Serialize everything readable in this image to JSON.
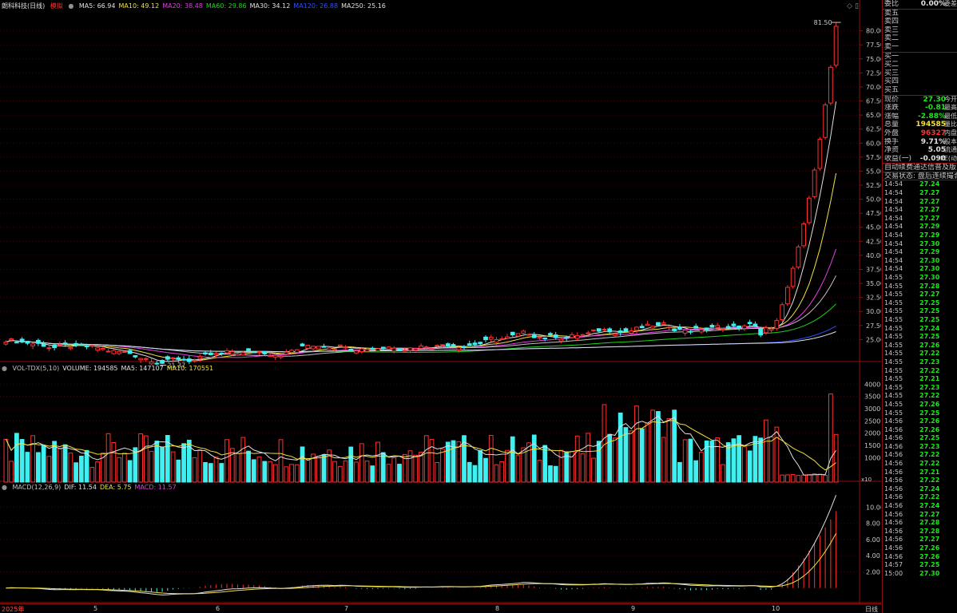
{
  "header": {
    "stock_name": "朗科科技(日线)",
    "mode": "模拟",
    "ma": [
      {
        "label": "MA5: 66.94",
        "color": "#e0e0e0"
      },
      {
        "label": "MA10: 49.12",
        "color": "#f0e040"
      },
      {
        "label": "MA20: 38.48",
        "color": "#e040e0"
      },
      {
        "label": "MA60: 29.86",
        "color": "#20d020"
      },
      {
        "label": "MA30: 34.12",
        "color": "#e0e0e0"
      },
      {
        "label": "MA120: 26.88",
        "color": "#3050ff"
      },
      {
        "label": "MA250: 25.16",
        "color": "#e0e0e0"
      }
    ],
    "vol": [
      {
        "label": "VOL-TDX(5,10)",
        "color": "#c0c0c0"
      },
      {
        "label": "VOLUME: 194585",
        "color": "#e0e0e0"
      },
      {
        "label": "MA5: 147107",
        "color": "#e0e0e0"
      },
      {
        "label": "MA10: 170551",
        "color": "#f0e040"
      }
    ],
    "macd": [
      {
        "label": "MACD(12,26,9)",
        "color": "#c0c0c0"
      },
      {
        "label": "DIF: 11.54",
        "color": "#e0e0e0"
      },
      {
        "label": "DEA: 5.75",
        "color": "#f0e040"
      },
      {
        "label": "MACD: 11.57",
        "color": "#e040e0"
      }
    ]
  },
  "chart_data": [
    {
      "type": "candlestick",
      "title": "朗科科技(日线)",
      "ylim": [
        21.5,
        83.5
      ],
      "price_ticks": [
        "80.00",
        "77.50",
        "75.00",
        "72.50",
        "70.00",
        "67.50",
        "65.00",
        "62.50",
        "60.00",
        "57.50",
        "55.00",
        "52.50",
        "50.00",
        "47.50",
        "45.00",
        "42.50",
        "40.00",
        "37.50",
        "35.00",
        "32.50",
        "30.00",
        "27.50",
        "25.00"
      ],
      "price_tick_values": [
        80,
        77.5,
        75,
        72.5,
        70,
        67.5,
        65,
        62.5,
        60,
        57.5,
        55,
        52.5,
        50,
        47.5,
        45,
        42.5,
        40,
        37.5,
        35,
        32.5,
        30,
        27.5,
        25
      ],
      "annotations": {
        "high": "81.50",
        "low": "21.37"
      },
      "x_labels": [
        "2025年",
        "5",
        "6",
        "7",
        "8",
        "9",
        "10"
      ],
      "recent_closes": [
        25.8,
        27.1,
        26.9,
        28.4,
        31.2,
        34.3,
        37.7,
        41.5,
        45.6,
        50.2,
        55.2,
        60.7,
        66.8,
        73.5,
        80.8
      ]
    },
    {
      "type": "bar",
      "title": "VOL-TDX(5,10)",
      "ylim": [
        0,
        45000
      ],
      "ticks": [
        "40000",
        "35000",
        "30000",
        "25000",
        "20000",
        "15000",
        "10000"
      ],
      "tick_values": [
        40000,
        35000,
        30000,
        25000,
        20000,
        15000,
        10000
      ],
      "unit": "x10"
    },
    {
      "type": "line",
      "title": "MACD(12,26,9)",
      "ylim": [
        -1.5,
        12
      ],
      "ticks": [
        "10.00",
        "8.00",
        "6.00",
        "4.00",
        "2.00"
      ],
      "tick_values": [
        10,
        8,
        6,
        4,
        2
      ]
    }
  ],
  "sidebar": {
    "top": [
      {
        "l": "委比",
        "v": "0.00%",
        "r": "委差",
        "vc": "white"
      }
    ],
    "sell": [
      "卖五",
      "卖四",
      "卖三",
      "卖二",
      "卖一"
    ],
    "buy": [
      "买一",
      "买二",
      "买三",
      "买四",
      "买五"
    ],
    "quote": [
      {
        "l": "现价",
        "v": "27.30",
        "r": "今开",
        "vc": "green"
      },
      {
        "l": "涨跌",
        "v": "-0.81",
        "r": "最高",
        "vc": "green"
      },
      {
        "l": "涨幅",
        "v": "-2.88%",
        "r": "最低",
        "vc": "green"
      },
      {
        "l": "总量",
        "v": "194585",
        "r": "量比",
        "vc": "yellow"
      },
      {
        "l": "外盘",
        "v": "96327",
        "r": "内盘",
        "vc": "red"
      },
      {
        "l": "换手",
        "v": "9.71%",
        "r": "股本",
        "vc": "white"
      },
      {
        "l": "净资",
        "v": "5.05",
        "r": "流通",
        "vc": "white"
      },
      {
        "l": "收益(一)",
        "v": "-0.090",
        "r": "PE(动",
        "vc": "white"
      }
    ],
    "notice": "自动续费通达信普及版",
    "status": "交易状态: 盘后连续撮合",
    "ticks": [
      {
        "t": "14:54",
        "p": "27.24",
        "c": "green"
      },
      {
        "t": "14:54",
        "p": "27.27",
        "c": "green"
      },
      {
        "t": "14:54",
        "p": "27.27",
        "c": "green"
      },
      {
        "t": "14:54",
        "p": "27.27",
        "c": "green"
      },
      {
        "t": "14:54",
        "p": "27.27",
        "c": "green"
      },
      {
        "t": "14:54",
        "p": "27.29",
        "c": "green"
      },
      {
        "t": "14:54",
        "p": "27.29",
        "c": "green"
      },
      {
        "t": "14:54",
        "p": "27.30",
        "c": "green"
      },
      {
        "t": "14:54",
        "p": "27.29",
        "c": "green"
      },
      {
        "t": "14:54",
        "p": "27.30",
        "c": "green"
      },
      {
        "t": "14:54",
        "p": "27.30",
        "c": "green"
      },
      {
        "t": "14:55",
        "p": "27.30",
        "c": "green"
      },
      {
        "t": "14:55",
        "p": "27.28",
        "c": "green"
      },
      {
        "t": "14:55",
        "p": "27.27",
        "c": "green"
      },
      {
        "t": "14:55",
        "p": "27.25",
        "c": "green"
      },
      {
        "t": "14:55",
        "p": "27.25",
        "c": "green"
      },
      {
        "t": "14:55",
        "p": "27.25",
        "c": "green"
      },
      {
        "t": "14:55",
        "p": "27.24",
        "c": "green"
      },
      {
        "t": "14:55",
        "p": "27.25",
        "c": "green"
      },
      {
        "t": "14:55",
        "p": "27.26",
        "c": "green"
      },
      {
        "t": "14:55",
        "p": "27.22",
        "c": "green"
      },
      {
        "t": "14:55",
        "p": "27.23",
        "c": "green"
      },
      {
        "t": "14:55",
        "p": "27.22",
        "c": "green"
      },
      {
        "t": "14:55",
        "p": "27.21",
        "c": "green"
      },
      {
        "t": "14:55",
        "p": "27.23",
        "c": "green"
      },
      {
        "t": "14:55",
        "p": "27.22",
        "c": "green"
      },
      {
        "t": "14:55",
        "p": "27.26",
        "c": "green"
      },
      {
        "t": "14:55",
        "p": "27.25",
        "c": "green"
      },
      {
        "t": "14:56",
        "p": "27.26",
        "c": "green"
      },
      {
        "t": "14:56",
        "p": "27.26",
        "c": "green"
      },
      {
        "t": "14:56",
        "p": "27.25",
        "c": "green"
      },
      {
        "t": "14:56",
        "p": "27.23",
        "c": "green"
      },
      {
        "t": "14:56",
        "p": "27.22",
        "c": "green"
      },
      {
        "t": "14:56",
        "p": "27.22",
        "c": "green"
      },
      {
        "t": "14:56",
        "p": "27.21",
        "c": "green"
      },
      {
        "t": "14:56",
        "p": "27.22",
        "c": "green"
      },
      {
        "t": "14:56",
        "p": "27.24",
        "c": "green"
      },
      {
        "t": "14:56",
        "p": "27.22",
        "c": "green"
      },
      {
        "t": "14:56",
        "p": "27.24",
        "c": "green"
      },
      {
        "t": "14:56",
        "p": "27.27",
        "c": "green"
      },
      {
        "t": "14:56",
        "p": "27.28",
        "c": "green"
      },
      {
        "t": "14:56",
        "p": "27.28",
        "c": "green"
      },
      {
        "t": "14:56",
        "p": "27.27",
        "c": "green"
      },
      {
        "t": "14:56",
        "p": "27.26",
        "c": "green"
      },
      {
        "t": "14:56",
        "p": "27.26",
        "c": "green"
      },
      {
        "t": "14:57",
        "p": "27.25",
        "c": "green"
      },
      {
        "t": "15:00",
        "p": "27.30",
        "c": "green"
      }
    ]
  },
  "footer": {
    "period": "日线",
    "year": "2025年"
  },
  "colors": {
    "up": "#ff3030",
    "down": "#40f0f0",
    "grid": "#8a1010",
    "axis_text": "#c8c8c8"
  },
  "icons": {
    "ma_dot": "circle-icon",
    "expand": "diamond-icon",
    "scroll": "double-bar-icon"
  }
}
